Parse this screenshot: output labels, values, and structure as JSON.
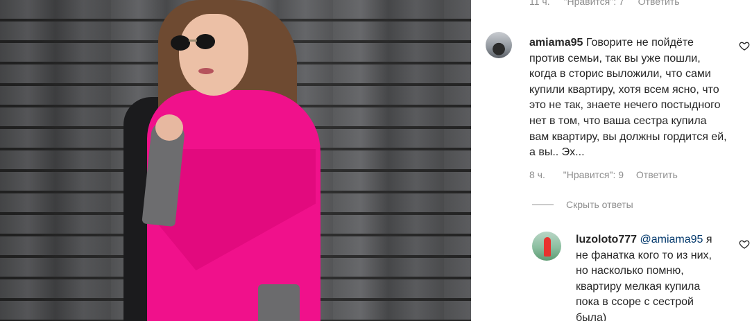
{
  "post_image": {
    "description_icon": "photo"
  },
  "comments_panel": {
    "previous_comment_meta": {
      "time": "11 ч.",
      "likes": "\"Нравится\": 7",
      "reply": "Ответить"
    },
    "comment_1": {
      "username": "amiama95",
      "text": "Говорите не пойдёте против семьи, так вы уже пошли, когда в сторис выложили, что сами купили квартиру, хотя всем ясно, что это не так, знаете нечего постыдного нет в том, что ваша сестра купила вам квартиру, вы должны гордится ей, а вы.. Эх...",
      "time": "8 ч.",
      "likes": "\"Нравится\": 9",
      "reply": "Ответить",
      "like_icon": "heart-icon"
    },
    "hide_replies_label": "Скрыть ответы",
    "reply_1": {
      "username": "luzoloto777",
      "mention": "@amiama95",
      "text": "я не фанатка кого то из них, но насколько помню, квартиру мелкая купила пока в ссоре с сестрой была)",
      "like_icon": "heart-icon"
    }
  },
  "colors": {
    "text": "#262626",
    "secondary_text": "#8e8e8e",
    "mention": "#00376b",
    "sweater_pink": "#f0118b"
  }
}
